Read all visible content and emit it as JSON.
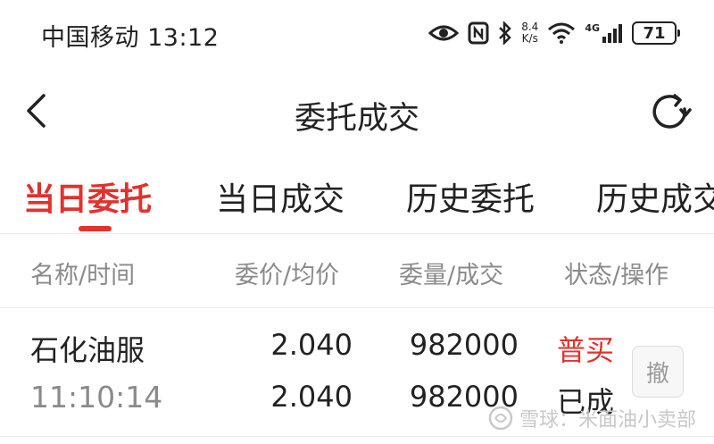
{
  "status_bar": {
    "carrier": "中国移动",
    "time": "13:12",
    "net_speed_value": "8.4",
    "net_speed_unit": "K/s",
    "network_type": "4G",
    "battery": "71"
  },
  "nav": {
    "title": "委托成交"
  },
  "tabs": [
    {
      "label": "当日委托",
      "active": true
    },
    {
      "label": "当日成交",
      "active": false
    },
    {
      "label": "历史委托",
      "active": false
    },
    {
      "label": "历史成交",
      "active": false
    }
  ],
  "table": {
    "columns": [
      "名称/时间",
      "委价/均价",
      "委量/成交",
      "状态/操作"
    ],
    "rows": [
      {
        "name": "石化油服",
        "time": "11:10:14",
        "order_price": "2.040",
        "avg_price": "2.040",
        "order_qty": "982000",
        "filled_qty": "982000",
        "direction": "普买",
        "status": "已成",
        "action": "撤"
      }
    ]
  },
  "watermark": {
    "text": "雪球：米面油小卖部"
  },
  "colors": {
    "accent_red": "#e0322f",
    "text_primary": "#222222",
    "text_secondary": "#8a8a8a"
  }
}
